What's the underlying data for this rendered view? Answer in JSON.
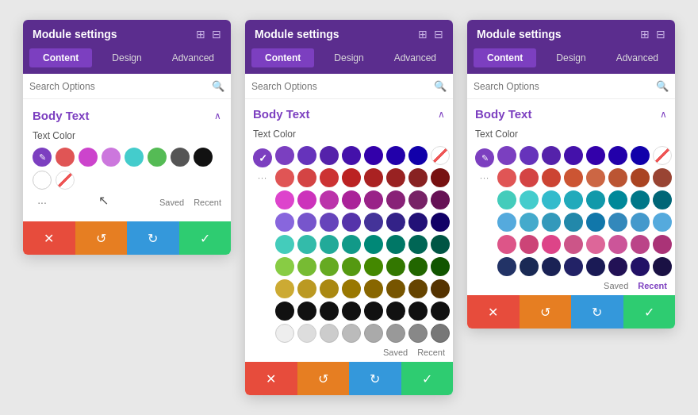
{
  "panels": [
    {
      "id": "panel1",
      "header": {
        "title": "Module settings",
        "icons": [
          "⊞",
          "⊟"
        ]
      },
      "tabs": [
        "Content",
        "Design",
        "Advanced"
      ],
      "active_tab": "Content",
      "search_placeholder": "Search Options",
      "section": {
        "title": "Body Text",
        "field_label": "Text Color",
        "mode": "compact",
        "saved_label": "Saved",
        "recent_label": "Recent",
        "active_saved": true
      }
    },
    {
      "id": "panel2",
      "header": {
        "title": "Module settings",
        "icons": [
          "⊞",
          "⊟"
        ]
      },
      "tabs": [
        "Content",
        "Design",
        "Advanced"
      ],
      "active_tab": "Content",
      "search_placeholder": "Search Options",
      "section": {
        "title": "Body Text",
        "field_label": "Text Color",
        "mode": "full-grid",
        "saved_label": "Saved",
        "recent_label": "Recent",
        "active_saved": true
      }
    },
    {
      "id": "panel3",
      "header": {
        "title": "Module settings",
        "icons": [
          "⊞",
          "⊟"
        ]
      },
      "tabs": [
        "Content",
        "Design",
        "Advanced"
      ],
      "active_tab": "Content",
      "search_placeholder": "Search Options",
      "section": {
        "title": "Body Text",
        "field_label": "Text Color",
        "mode": "recent-grid",
        "saved_label": "Saved",
        "recent_label": "Recent",
        "active_recent": true
      }
    }
  ],
  "footer": {
    "cancel": "✕",
    "undo": "↺",
    "redo": "↻",
    "confirm": "✓"
  }
}
